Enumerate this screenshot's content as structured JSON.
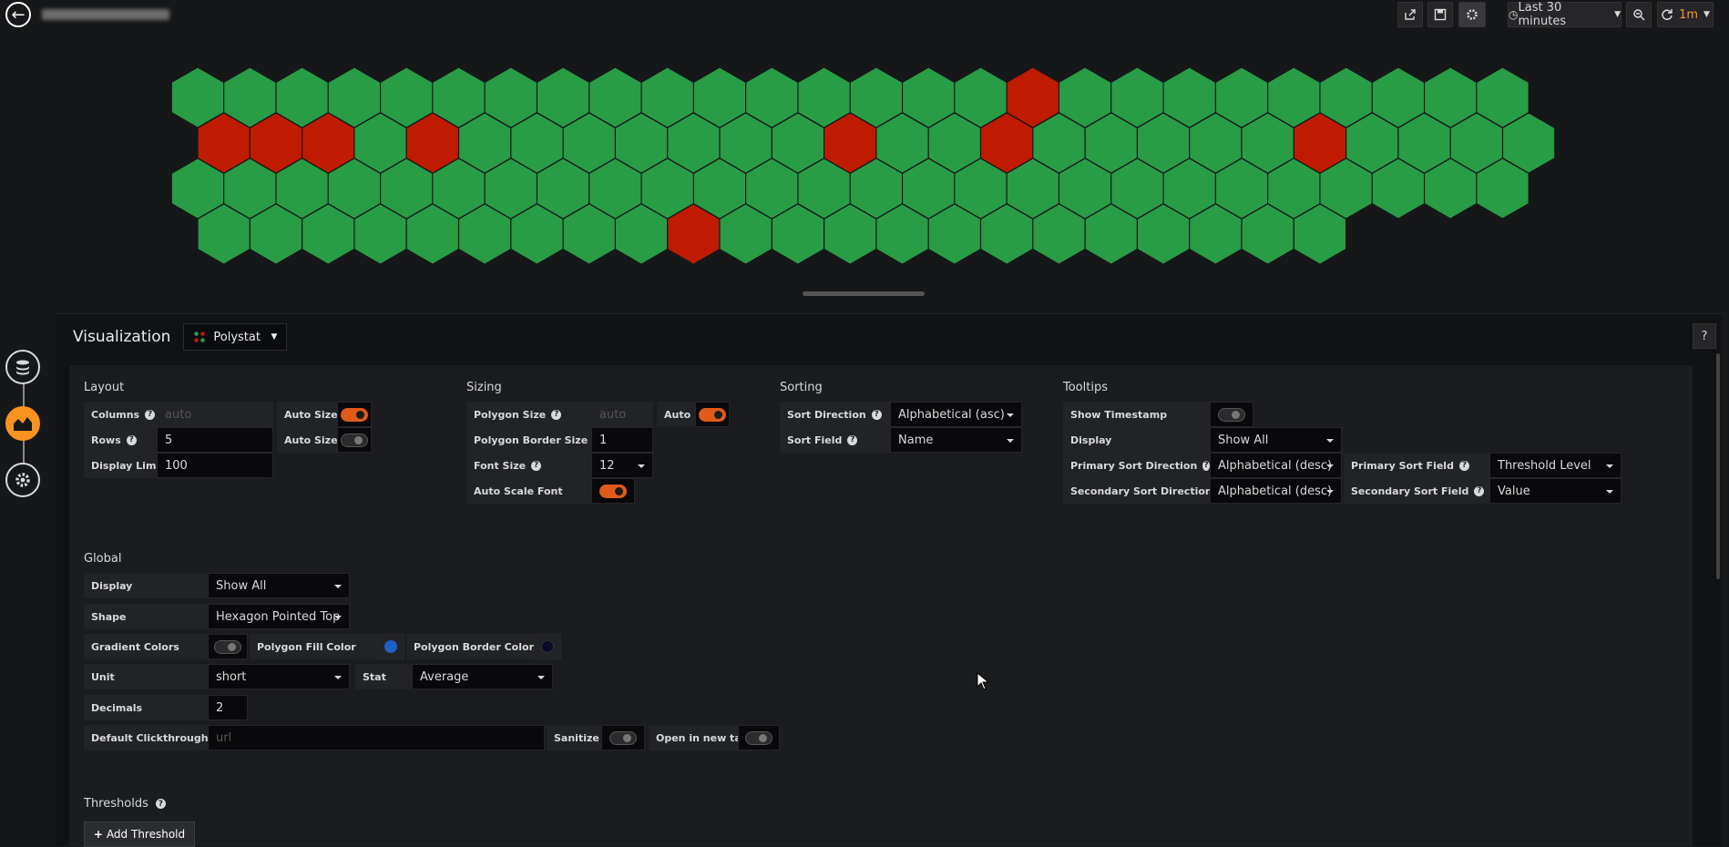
{
  "topbar": {
    "time_range": "Last 30 minutes",
    "refresh_interval": "1m",
    "icons": [
      "back-arrow-icon",
      "share-icon",
      "save-icon",
      "gear-icon",
      "clock-icon",
      "zoom-out-icon",
      "refresh-icon"
    ]
  },
  "honeycomb": {
    "colors": {
      "ok": "#299c46",
      "critical": "#bf1b00"
    },
    "rows": [
      {
        "count": 26,
        "critical": [
          16
        ]
      },
      {
        "count": 26,
        "critical": [
          0,
          1,
          2,
          4,
          12,
          15,
          21
        ]
      },
      {
        "count": 26,
        "critical": []
      },
      {
        "count": 22,
        "critical": [
          9
        ]
      }
    ]
  },
  "visualization": {
    "heading": "Visualization",
    "plugin": "Polystat",
    "help": "?"
  },
  "layout": {
    "title": "Layout",
    "columns_label": "Columns",
    "columns_placeholder": "auto",
    "auto_size_label": "Auto Size",
    "columns_auto": true,
    "rows_label": "Rows",
    "rows_value": "5",
    "rows_auto": false,
    "display_limit_label": "Display Limit",
    "display_limit_value": "100"
  },
  "sizing": {
    "title": "Sizing",
    "polygon_size_label": "Polygon Size",
    "polygon_size_placeholder": "auto",
    "auto_label": "Auto",
    "auto_on": true,
    "border_size_label": "Polygon Border Size",
    "border_size_value": "1",
    "font_size_label": "Font Size",
    "font_size_value": "12",
    "auto_scale_label": "Auto Scale Font",
    "auto_scale_on": true
  },
  "sorting": {
    "title": "Sorting",
    "direction_label": "Sort Direction",
    "direction_value": "Alphabetical (asc)",
    "field_label": "Sort Field",
    "field_value": "Name"
  },
  "tooltips": {
    "title": "Tooltips",
    "show_timestamp_label": "Show Timestamp",
    "show_timestamp_on": false,
    "display_label": "Display",
    "display_value": "Show All",
    "primary_dir_label": "Primary Sort Direction",
    "primary_dir_value": "Alphabetical (desc)",
    "primary_field_label": "Primary Sort Field",
    "primary_field_value": "Threshold Level",
    "secondary_dir_label": "Secondary Sort Direction",
    "secondary_dir_value": "Alphabetical (desc)",
    "secondary_field_label": "Secondary Sort Field",
    "secondary_field_value": "Value"
  },
  "global": {
    "title": "Global",
    "display_label": "Display",
    "display_value": "Show All",
    "shape_label": "Shape",
    "shape_value": "Hexagon Pointed Top",
    "gradient_label": "Gradient Colors",
    "gradient_on": false,
    "fill_color_label": "Polygon Fill Color",
    "fill_color": "#1f60c4",
    "border_color_label": "Polygon Border Color",
    "border_color": "#0b0c2a",
    "unit_label": "Unit",
    "unit_value": "short",
    "stat_label": "Stat",
    "stat_value": "Average",
    "decimals_label": "Decimals",
    "decimals_value": "2",
    "clickthrough_label": "Default Clickthrough",
    "clickthrough_placeholder": "url",
    "sanitize_label": "Sanitize",
    "sanitize_on": false,
    "new_tab_label": "Open in new tab",
    "new_tab_on": false
  },
  "thresholds": {
    "title": "Thresholds",
    "add_label": "Add Threshold"
  }
}
